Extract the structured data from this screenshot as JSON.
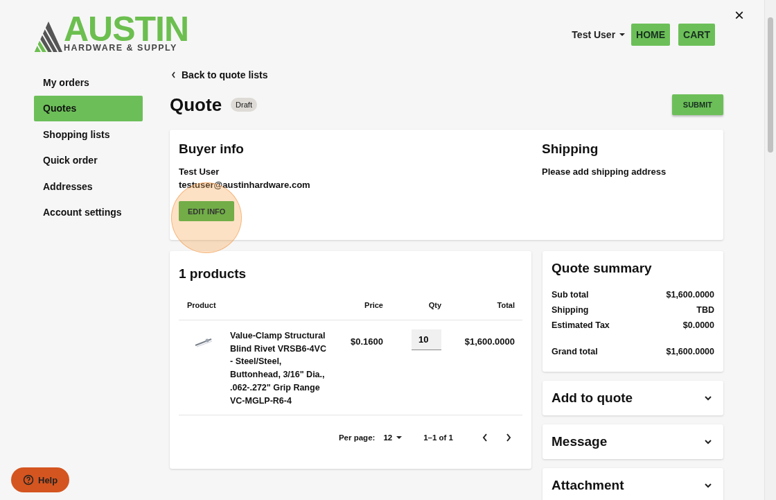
{
  "header": {
    "logo": {
      "name": "AUSTIN",
      "tagline": "HARDWARE & SUPPLY"
    },
    "user_menu": "Test User",
    "buttons": [
      "HOME",
      "CART"
    ],
    "close": "×"
  },
  "sidebar": {
    "items": [
      {
        "label": "My orders",
        "selected": false
      },
      {
        "label": "Quotes",
        "selected": true
      },
      {
        "label": "Shopping lists",
        "selected": false
      },
      {
        "label": "Quick order",
        "selected": false
      },
      {
        "label": "Addresses",
        "selected": false
      },
      {
        "label": "Account settings",
        "selected": false
      }
    ]
  },
  "back_link": "Back to quote lists",
  "title": "Quote",
  "status_badge": "Draft",
  "submit": "SUBMIT",
  "buyer_info": {
    "heading": "Buyer info",
    "name": "Test User",
    "email": "testuser@austinhardware.com",
    "button": "EDIT INFO",
    "highlighted": true
  },
  "shipping": {
    "heading": "Shipping",
    "message": "Please add shipping address"
  },
  "products": {
    "heading": "1 products",
    "columns": [
      "Product",
      "Price",
      "Qty",
      "Total"
    ],
    "rows": [
      {
        "name": "Value-Clamp Structural Blind Rivet VRSB6-4VC - Steel/Steel, Buttonhead, 3/16\" Dia., .062-.272\" Grip Range VC-MGLP-R6-4",
        "price": "$0.1600",
        "qty": "10",
        "total": "$1,600.0000"
      }
    ],
    "pagination": {
      "per_page_label": "Per page:",
      "per_page": "12",
      "range": "1–1 of 1"
    }
  },
  "summary": {
    "heading": "Quote summary",
    "lines": [
      {
        "label": "Sub total",
        "value": "$1,600.0000"
      },
      {
        "label": "Shipping",
        "value": "TBD"
      },
      {
        "label": "Estimated Tax",
        "value": "$0.0000"
      }
    ],
    "grand_total": {
      "label": "Grand total",
      "value": "$1,600.0000"
    }
  },
  "sections": [
    {
      "title": "Add to quote",
      "expanded": false
    },
    {
      "title": "Message",
      "expanded": false
    },
    {
      "title": "Attachment",
      "expanded": false
    }
  ],
  "help": "Help"
}
